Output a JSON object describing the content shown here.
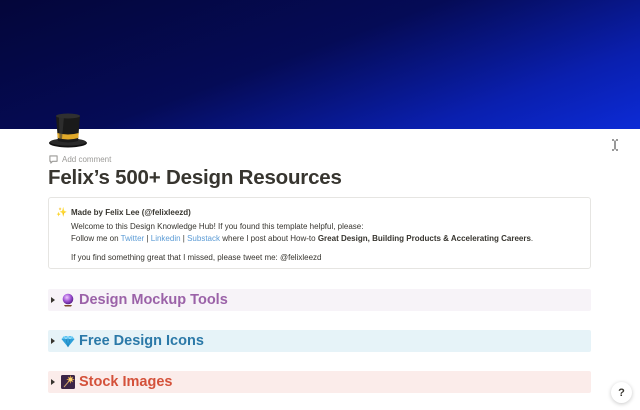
{
  "page": {
    "cover_colors": [
      "#04063a",
      "#0a1fae",
      "#0c2bd6"
    ],
    "icon": "top-hat-icon",
    "add_comment_label": "Add comment",
    "title": "Felix’s 500+ Design Resources"
  },
  "callout": {
    "icon": "sparkles-icon",
    "heading": "Made by Felix Lee (@felixleezd)",
    "line1": "Welcome to this Design Knowledge Hub! If you found this template helpful, please:",
    "line2": {
      "prefix": "Follow me on ",
      "twitter": "Twitter",
      "sep1": " | ",
      "linkedin": "Linkedin",
      "sep2": " | ",
      "substack": "Substack",
      "middle": " where I post about How-to ",
      "bold": "Great Design, Building Products & Accelerating Careers",
      "suffix": "."
    },
    "line3": "If you find something great that I missed, please tweet me: @felixleezd",
    "link_color": "#5b9bd5"
  },
  "toggles": [
    {
      "icon": "crystal-ball-icon",
      "label": "Design Mockup Tools",
      "color": "#9b62a8",
      "bg": "#f7f3f8"
    },
    {
      "icon": "gem-icon",
      "label": "Free Design Icons",
      "color": "#2b79a8",
      "bg": "#e6f3f8"
    },
    {
      "icon": "sparkler-icon",
      "label": "Stock Images",
      "color": "#d4513a",
      "bg": "#fbecea"
    }
  ],
  "help": {
    "label": "?"
  }
}
